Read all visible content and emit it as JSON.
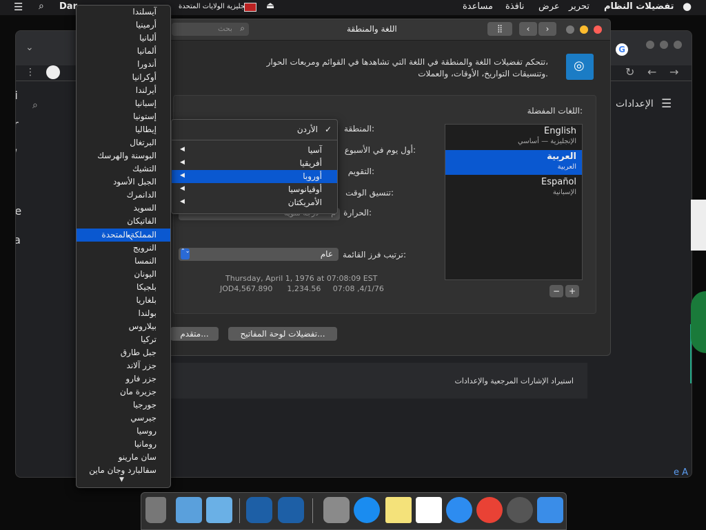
{
  "menubar": {
    "apple": "",
    "app_name": "تفضيلات النظام",
    "items": [
      "تحرير",
      "عرض",
      "نافذة",
      "مساعدة"
    ],
    "input_source": "إنجليزية الولايات المتحدة",
    "left_text": "Dar"
  },
  "prefs": {
    "title": "اللغة والمنطقة",
    "search_placeholder": "بحث",
    "description_line1": "تتحكم تفضيلات اللغة والمنطقة في اللغة التي تشاهدها في القوائم ومربعات الحوار،",
    "description_line2": "وتنسيقات التواريخ، الأوقات، والعملات.",
    "preferred_languages_label": "اللغات المفضلة:",
    "languages": [
      {
        "name": "English",
        "sub": "الإنجليزية — أساسي"
      },
      {
        "name": "العربية",
        "sub": "العربية"
      },
      {
        "name": "Español",
        "sub": "الإسبانية"
      }
    ],
    "labels": {
      "region": "المنطقة:",
      "first_day": "أول يوم في الأسبوع:",
      "calendar": "التقويم:",
      "time_format": "تنسيق الوقت:",
      "temperature": "الحرارة:",
      "list_sort": "ترتيب فرز القائمة:"
    },
    "temperature_value": "م — درجة مئوية",
    "list_sort_value": "عام",
    "sample_date": "Thursday, April 1, 1976 at 07:08:09 EST",
    "sample_numbers": "JOD4,567.890      1,234.56     07:08 ,4/1/76",
    "keyboard_button": "تفضيلات لوحة المفاتيح...",
    "advanced_button": "متقدم...",
    "add": "+",
    "remove": "−"
  },
  "region_menu": {
    "current": "الأردن",
    "items": [
      "آسيا",
      "أفريقيا",
      "أوروبا",
      "أوقيانوسيا",
      "الأمريكتان"
    ]
  },
  "country_list": [
    "آيسلندا",
    "أرمينيا",
    "ألبانيا",
    "ألمانيا",
    "أندورا",
    "أوكرانيا",
    "أيرلندا",
    "إسبانيا",
    "إستونيا",
    "إيطاليا",
    "البرتغال",
    "البوسنة والهرسك",
    "التشيك",
    "الجبل الأسود",
    "الدانمرك",
    "السويد",
    "الفاتيكان",
    "المملكة المتحدة",
    "النرويج",
    "النمسا",
    "اليونان",
    "بلجيكا",
    "بلغاريا",
    "بولندا",
    "بيلاروس",
    "تركيا",
    "جبل طارق",
    "جزر آلاند",
    "جزر فارو",
    "جزيرة مان",
    "جورجيا",
    "جيرسي",
    "روسيا",
    "رومانيا",
    "سان مارينو",
    "سفالبارد وجان ماين"
  ],
  "chrome": {
    "settings_title": "الإعدادات",
    "import_label": "استيراد الإشارات المرجعية والإعدادات",
    "sidebar_letters": [
      "Di",
      "Cr",
      "W",
      "Pl",
      "De",
      "Ca",
      "U"
    ],
    "right_text": "e A"
  },
  "colors": {
    "accent": "#0a58d0",
    "menubar": "#1c1c1e"
  }
}
